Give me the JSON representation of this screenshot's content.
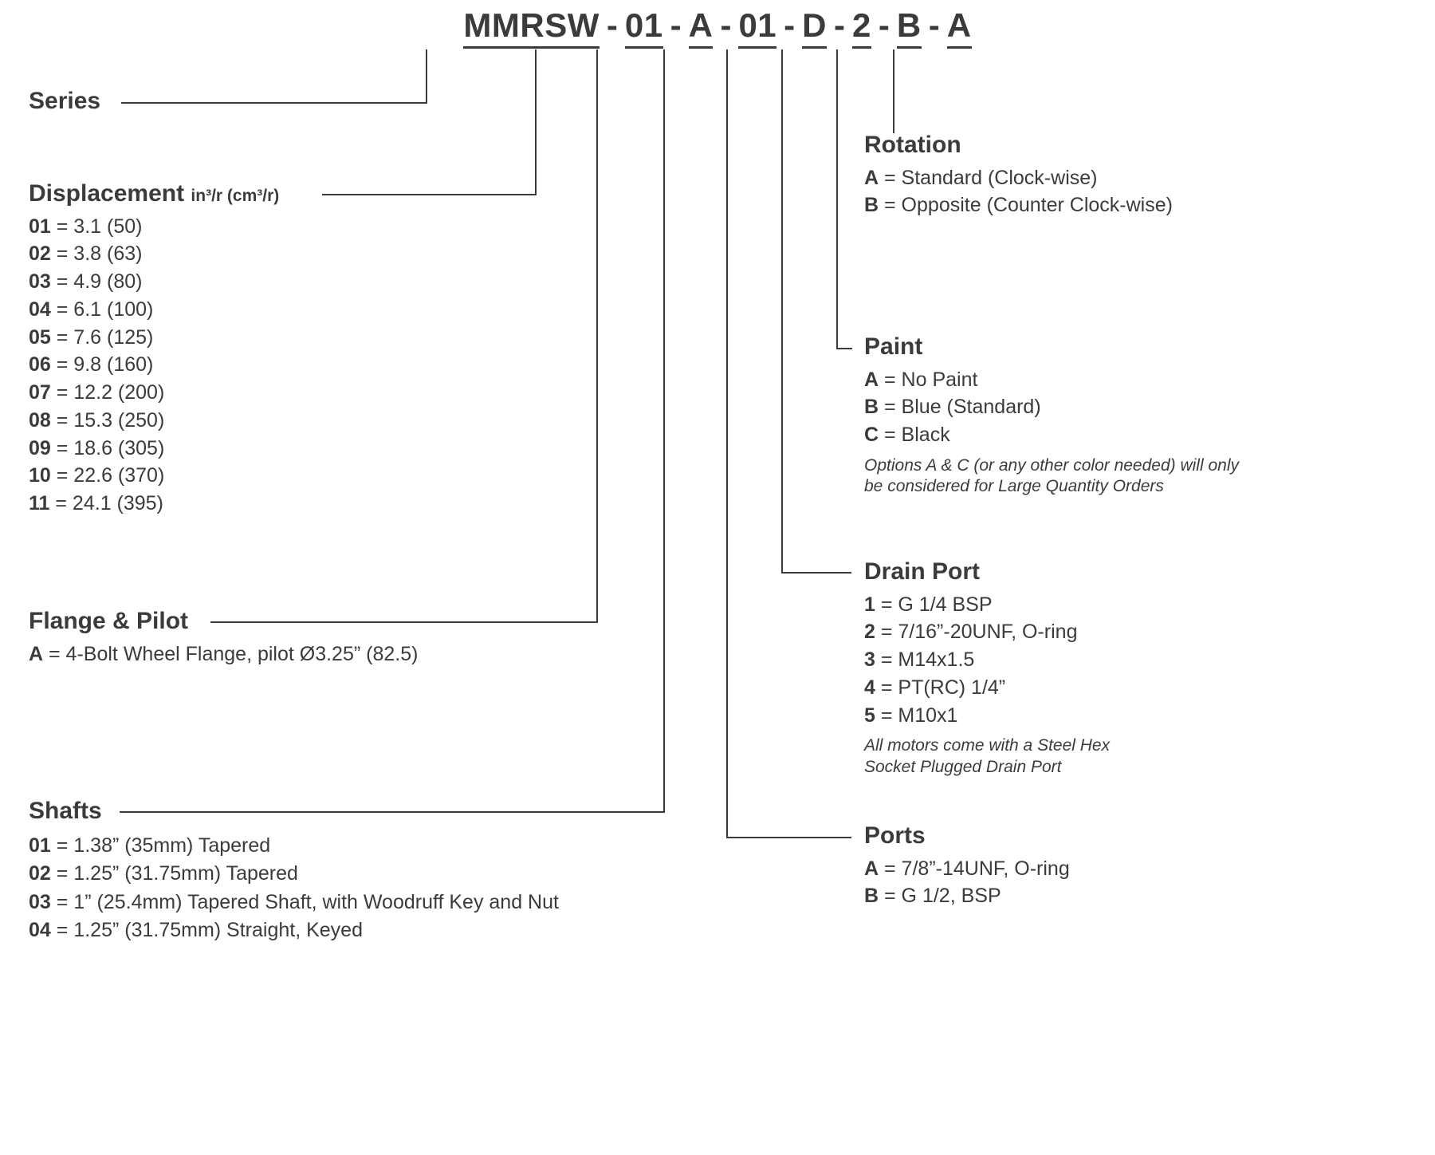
{
  "model_code": {
    "segments": [
      "MMRSW",
      "01",
      "A",
      "01",
      "D",
      "2",
      "B",
      "A"
    ],
    "separator": "-"
  },
  "sections": {
    "series": {
      "title": "Series"
    },
    "displacement": {
      "title": "Displacement",
      "unit": "in³/r (cm³/r)",
      "options": [
        {
          "key": "01",
          "value": "= 3.1 (50)"
        },
        {
          "key": "02",
          "value": "= 3.8 (63)"
        },
        {
          "key": "03",
          "value": "= 4.9 (80)"
        },
        {
          "key": "04",
          "value": "= 6.1 (100)"
        },
        {
          "key": "05",
          "value": "= 7.6 (125)"
        },
        {
          "key": "06",
          "value": "= 9.8 (160)"
        },
        {
          "key": "07",
          "value": "= 12.2 (200)"
        },
        {
          "key": "08",
          "value": "= 15.3 (250)"
        },
        {
          "key": "09",
          "value": "= 18.6 (305)"
        },
        {
          "key": "10",
          "value": "= 22.6 (370)"
        },
        {
          "key": "11",
          "value": "= 24.1 (395)"
        }
      ]
    },
    "flange_pilot": {
      "title": "Flange & Pilot",
      "options": [
        {
          "key": "A",
          "value": "= 4-Bolt Wheel Flange, pilot Ø3.25” (82.5)"
        }
      ]
    },
    "shafts": {
      "title": "Shafts",
      "options": [
        {
          "key": "01",
          "value": "= 1.38” (35mm) Tapered"
        },
        {
          "key": "02",
          "value": "= 1.25” (31.75mm) Tapered"
        },
        {
          "key": "03",
          "value": "= 1” (25.4mm) Tapered Shaft, with Woodruff Key and Nut"
        },
        {
          "key": "04",
          "value": "= 1.25” (31.75mm) Straight, Keyed"
        }
      ]
    },
    "rotation": {
      "title": "Rotation",
      "options": [
        {
          "key": "A",
          "value": "= Standard (Clock-wise)"
        },
        {
          "key": "B",
          "value": "= Opposite (Counter Clock-wise)"
        }
      ]
    },
    "paint": {
      "title": "Paint",
      "options": [
        {
          "key": "A",
          "value": "= No Paint"
        },
        {
          "key": "B",
          "value": "= Blue (Standard)"
        },
        {
          "key": "C",
          "value": "= Black"
        }
      ],
      "note": "Options A & C (or any other color needed) will only be considered for Large Quantity Orders"
    },
    "drain_port": {
      "title": "Drain Port",
      "options": [
        {
          "key": "1",
          "value": "= G 1/4 BSP"
        },
        {
          "key": "2",
          "value": "= 7/16”-20UNF, O-ring"
        },
        {
          "key": "3",
          "value": "= M14x1.5"
        },
        {
          "key": "4",
          "value": "= PT(RC) 1/4”"
        },
        {
          "key": "5",
          "value": "= M10x1"
        }
      ],
      "note": "All motors come with a Steel Hex Socket Plugged Drain Port"
    },
    "ports": {
      "title": "Ports",
      "options": [
        {
          "key": "A",
          "value": "= 7/8”-14UNF, O-ring"
        },
        {
          "key": "B",
          "value": "= G 1/2, BSP"
        }
      ]
    }
  },
  "colors": {
    "text": "#3b3b3b",
    "line": "#3b3b3b",
    "background": "#ffffff"
  }
}
